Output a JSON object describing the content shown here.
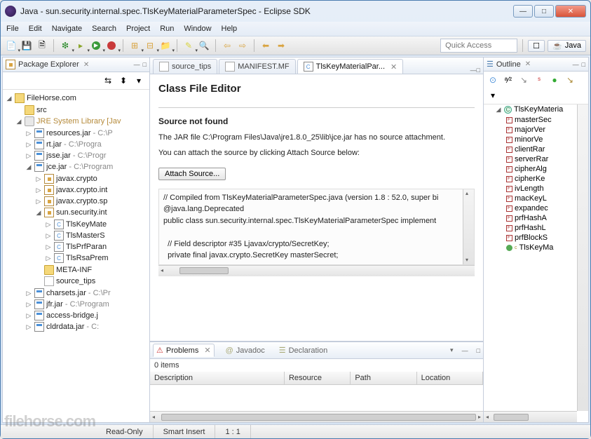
{
  "window": {
    "title": "Java - sun.security.internal.spec.TlsKeyMaterialParameterSpec - Eclipse SDK"
  },
  "menu": [
    "File",
    "Edit",
    "Navigate",
    "Search",
    "Project",
    "Run",
    "Window",
    "Help"
  ],
  "quick_access_placeholder": "Quick Access",
  "perspective": {
    "label": "Java"
  },
  "package_explorer": {
    "title": "Package Explorer",
    "root": "FileHorse.com",
    "src": "src",
    "jre_label": "JRE System Library",
    "jre_profile": "[Jav",
    "jars": [
      {
        "name": "resources.jar",
        "path": " - C:\\P"
      },
      {
        "name": "rt.jar",
        "path": " - C:\\Progra"
      },
      {
        "name": "jsse.jar",
        "path": " - C:\\Progr"
      },
      {
        "name": "jce.jar",
        "path": " - C:\\Program",
        "expanded": true
      },
      {
        "name": "charsets.jar",
        "path": " - C:\\Pr"
      },
      {
        "name": "jfr.jar",
        "path": " - C:\\Program"
      },
      {
        "name": "access-bridge.j",
        "path": ""
      },
      {
        "name": "cldrdata.jar",
        "path": " - C:"
      }
    ],
    "jce_pkgs": [
      "javax.crypto",
      "javax.crypto.int",
      "javax.crypto.sp",
      "sun.security.int"
    ],
    "sun_classes": [
      "TlsKeyMate",
      "TlsMasterS",
      "TlsPrfParan",
      "TlsRsaPrem"
    ],
    "meta_inf": "META-INF",
    "source_tips": "source_tips"
  },
  "editor": {
    "tabs": [
      {
        "label": "source_tips",
        "icon": "file"
      },
      {
        "label": "MANIFEST.MF",
        "icon": "file"
      },
      {
        "label": "TlsKeyMaterialPar...",
        "icon": "cls",
        "active": true
      }
    ],
    "title": "Class File Editor",
    "heading": "Source not found",
    "line1": "The JAR file C:\\Program Files\\Java\\jre1.8.0_25\\lib\\jce.jar has no source attachment.",
    "line2": "You can attach the source by clicking Attach Source below:",
    "button": "Attach Source...",
    "code": "// Compiled from TlsKeyMaterialParameterSpec.java (version 1.8 : 52.0, super bi\n@java.lang.Deprecated\npublic class sun.security.internal.spec.TlsKeyMaterialParameterSpec implement\n\n  // Field descriptor #35 Ljavax/crypto/SecretKey;\n  private final javax.crypto.SecretKey masterSecret;"
  },
  "problems": {
    "tabs": [
      "Problems",
      "Javadoc",
      "Declaration"
    ],
    "count": "0 items",
    "columns": [
      "Description",
      "Resource",
      "Path",
      "Location"
    ]
  },
  "outline": {
    "title": "Outline",
    "class": "TlsKeyMateria",
    "fields": [
      "masterSec",
      "majorVer",
      "minorVe",
      "clientRar",
      "serverRar",
      "cipherAlg",
      "cipherKe",
      "ivLength",
      "macKeyL",
      "expandec",
      "prfHashA",
      "prfHashL",
      "prfBlockS"
    ],
    "ctor": "TlsKeyMa"
  },
  "status": {
    "readonly": "Read-Only",
    "insert": "Smart Insert",
    "pos": "1 : 1"
  },
  "watermark": "filehorse.com"
}
